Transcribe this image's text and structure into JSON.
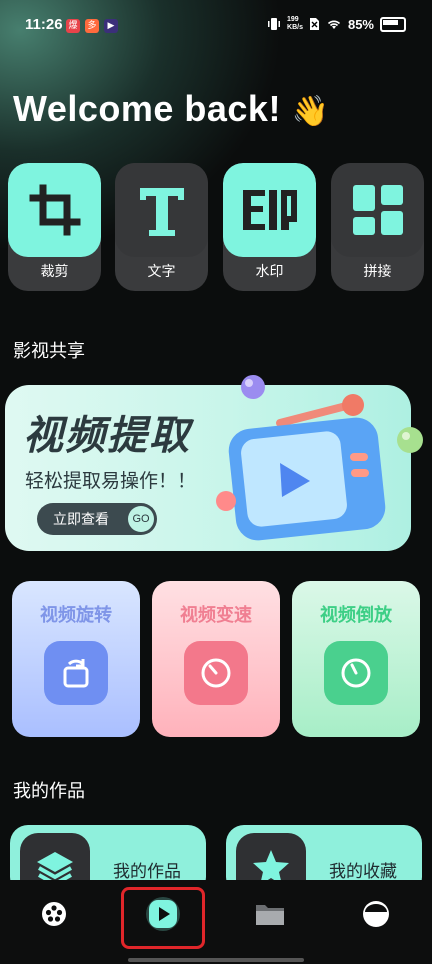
{
  "status_bar": {
    "time": "11:26",
    "speed_value": "199",
    "speed_unit": "KB/s",
    "battery": "85%"
  },
  "welcome": {
    "text": "Welcome back!",
    "emoji": "👋"
  },
  "tools": [
    {
      "label": "裁剪",
      "icon": "crop-icon",
      "style": "mint"
    },
    {
      "label": "文字",
      "icon": "text-icon",
      "style": "dark"
    },
    {
      "label": "水印",
      "icon": "watermark-icon",
      "style": "mint"
    },
    {
      "label": "拼接",
      "icon": "collage-icon",
      "style": "dark"
    }
  ],
  "section_share": "影视共享",
  "banner": {
    "title": "视频提取",
    "subtitle": "轻松提取易操作！！",
    "cta": "立即查看",
    "cta_go": "GO"
  },
  "features": [
    {
      "label": "视频旋转",
      "icon": "rotate-icon",
      "color": "#7f95e8"
    },
    {
      "label": "视频变速",
      "icon": "speed-gauge-icon",
      "color": "#f07f92"
    },
    {
      "label": "视频倒放",
      "icon": "reverse-gauge-icon",
      "color": "#3dcf86"
    }
  ],
  "section_works": "我的作品",
  "works": [
    {
      "label": "我的作品",
      "icon": "layers-icon"
    },
    {
      "label": "我的收藏",
      "icon": "star-icon"
    }
  ],
  "nav": [
    {
      "name": "film-reel",
      "icon": "film-reel-icon"
    },
    {
      "name": "play",
      "icon": "play-icon",
      "active": true
    },
    {
      "name": "folder",
      "icon": "folder-icon"
    },
    {
      "name": "profile",
      "icon": "profile-icon"
    }
  ],
  "colors": {
    "accent": "#7ff4df",
    "background": "#0b0d0d",
    "highlight": "#e0262a"
  }
}
